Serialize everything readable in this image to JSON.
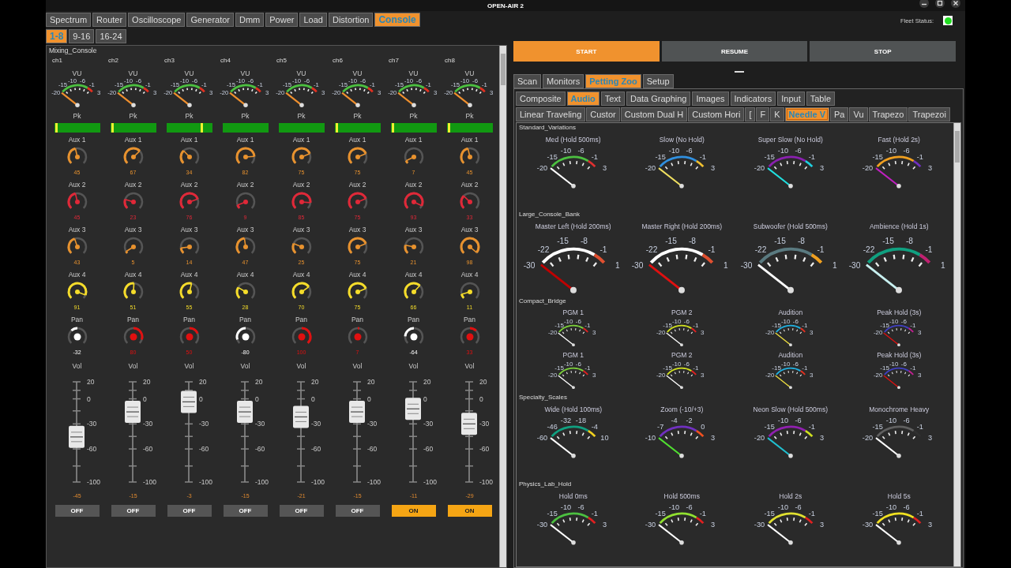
{
  "window": {
    "title": "OPEN-AIR 2"
  },
  "main_tabs": [
    {
      "label": "Spectrum",
      "selected": false
    },
    {
      "label": "Router",
      "selected": false
    },
    {
      "label": "Oscilloscope",
      "selected": false
    },
    {
      "label": "Generator",
      "selected": false
    },
    {
      "label": "Dmm",
      "selected": false
    },
    {
      "label": "Power",
      "selected": false
    },
    {
      "label": "Load",
      "selected": false
    },
    {
      "label": "Distortion",
      "selected": false
    },
    {
      "label": "Console",
      "selected": true
    }
  ],
  "bank_tabs": [
    {
      "label": "1-8",
      "selected": true
    },
    {
      "label": "9-16",
      "selected": false
    },
    {
      "label": "16-24",
      "selected": false
    }
  ],
  "console": {
    "title": "Mixing_Console",
    "channels": [
      {
        "name": "ch1",
        "vu": {
          "label": "VU",
          "scale": [
            "-20",
            "-15",
            "-10",
            "-6",
            "-1",
            "3"
          ]
        },
        "peak": {
          "label": "Pk",
          "level": 0.02
        },
        "knobs": [
          {
            "kind": "aux",
            "label": "Aux 1",
            "reading": "45",
            "color": "#e8922e"
          },
          {
            "kind": "aux",
            "label": "Aux 2",
            "reading": "45",
            "color": "#e02838"
          },
          {
            "kind": "aux",
            "label": "Aux 3",
            "reading": "43",
            "color": "#e8922e"
          },
          {
            "kind": "aux",
            "label": "Aux 4",
            "reading": "91",
            "color": "#f5dc2a"
          },
          {
            "kind": "pan",
            "label": "Pan",
            "reading": "-32",
            "color": "#ffffff"
          }
        ],
        "fader": {
          "label": "Vol",
          "scale": [
            "20",
            "0",
            "-30",
            "-60",
            "-100"
          ],
          "level": 0.45,
          "reading": "-45"
        },
        "mute": {
          "label": "OFF",
          "on": false
        }
      },
      {
        "name": "ch2",
        "vu": {
          "label": "VU",
          "scale": [
            "-20",
            "-15",
            "-10",
            "-6",
            "-1",
            "3"
          ]
        },
        "peak": {
          "label": "Pk",
          "level": 0.02
        },
        "knobs": [
          {
            "kind": "aux",
            "label": "Aux 1",
            "reading": "67",
            "color": "#e8922e"
          },
          {
            "kind": "aux",
            "label": "Aux 2",
            "reading": "23",
            "color": "#e02838"
          },
          {
            "kind": "aux",
            "label": "Aux 3",
            "reading": "5",
            "color": "#e8922e"
          },
          {
            "kind": "aux",
            "label": "Aux 4",
            "reading": "51",
            "color": "#f5dc2a"
          },
          {
            "kind": "pan",
            "label": "Pan",
            "reading": "80",
            "color": "#e01010"
          }
        ],
        "fader": {
          "label": "Vol",
          "scale": [
            "20",
            "0",
            "-30",
            "-60",
            "-100"
          ],
          "level": 0.7,
          "reading": "-15"
        },
        "mute": {
          "label": "OFF",
          "on": false
        }
      },
      {
        "name": "ch3",
        "vu": {
          "label": "VU",
          "scale": [
            "-20",
            "-15",
            "-10",
            "-6",
            "-1",
            "3"
          ]
        },
        "peak": {
          "label": "Pk",
          "level": 0.75
        },
        "knobs": [
          {
            "kind": "aux",
            "label": "Aux 1",
            "reading": "34",
            "color": "#e8922e"
          },
          {
            "kind": "aux",
            "label": "Aux 2",
            "reading": "76",
            "color": "#e02838"
          },
          {
            "kind": "aux",
            "label": "Aux 3",
            "reading": "14",
            "color": "#e8922e"
          },
          {
            "kind": "aux",
            "label": "Aux 4",
            "reading": "55",
            "color": "#f5dc2a"
          },
          {
            "kind": "pan",
            "label": "Pan",
            "reading": "50",
            "color": "#e01010"
          }
        ],
        "fader": {
          "label": "Vol",
          "scale": [
            "20",
            "0",
            "-30",
            "-60",
            "-100"
          ],
          "level": 0.8,
          "reading": "-3"
        },
        "mute": {
          "label": "OFF",
          "on": false
        }
      },
      {
        "name": "ch4",
        "vu": {
          "label": "VU",
          "scale": [
            "-20",
            "-15",
            "-10",
            "-6",
            "-1",
            "3"
          ]
        },
        "peak": {
          "label": "Pk"
        },
        "knobs": [
          {
            "kind": "aux",
            "label": "Aux 1",
            "reading": "82",
            "color": "#e8922e"
          },
          {
            "kind": "aux",
            "label": "Aux 2",
            "reading": "9",
            "color": "#e02838"
          },
          {
            "kind": "aux",
            "label": "Aux 3",
            "reading": "47",
            "color": "#e8922e"
          },
          {
            "kind": "aux",
            "label": "Aux 4",
            "reading": "28",
            "color": "#f5dc2a"
          },
          {
            "kind": "pan",
            "label": "Pan",
            "reading": "-80",
            "color": "#ffffff"
          }
        ],
        "fader": {
          "label": "Vol",
          "scale": [
            "20",
            "0",
            "-30",
            "-60",
            "-100"
          ],
          "level": 0.7,
          "reading": "-15"
        },
        "mute": {
          "label": "OFF",
          "on": false
        }
      },
      {
        "name": "ch5",
        "vu": {
          "label": "VU",
          "scale": [
            "-20",
            "-15",
            "-10",
            "-6",
            "-1",
            "3"
          ]
        },
        "peak": {
          "label": "Pk"
        },
        "knobs": [
          {
            "kind": "aux",
            "label": "Aux 1",
            "reading": "75",
            "color": "#e8922e"
          },
          {
            "kind": "aux",
            "label": "Aux 2",
            "reading": "85",
            "color": "#e02838"
          },
          {
            "kind": "aux",
            "label": "Aux 3",
            "reading": "25",
            "color": "#e8922e"
          },
          {
            "kind": "aux",
            "label": "Aux 4",
            "reading": "70",
            "color": "#f5dc2a"
          },
          {
            "kind": "pan",
            "label": "Pan",
            "reading": "100",
            "color": "#e01010"
          }
        ],
        "fader": {
          "label": "Vol",
          "scale": [
            "20",
            "0",
            "-30",
            "-60",
            "-100"
          ],
          "level": 0.65,
          "reading": "-21"
        },
        "mute": {
          "label": "OFF",
          "on": false
        }
      },
      {
        "name": "ch6",
        "vu": {
          "label": "VU",
          "scale": [
            "-20",
            "-15",
            "-10",
            "-6",
            "-1",
            "3"
          ]
        },
        "peak": {
          "label": "Pk",
          "level": 0.02
        },
        "knobs": [
          {
            "kind": "aux",
            "label": "Aux 1",
            "reading": "75",
            "color": "#e8922e"
          },
          {
            "kind": "aux",
            "label": "Aux 2",
            "reading": "75",
            "color": "#e02838"
          },
          {
            "kind": "aux",
            "label": "Aux 3",
            "reading": "75",
            "color": "#e8922e"
          },
          {
            "kind": "aux",
            "label": "Aux 4",
            "reading": "75",
            "color": "#f5dc2a"
          },
          {
            "kind": "pan",
            "label": "Pan",
            "reading": "7",
            "color": "#e01010"
          }
        ],
        "fader": {
          "label": "Vol",
          "scale": [
            "20",
            "0",
            "-30",
            "-60",
            "-100"
          ],
          "level": 0.7,
          "reading": "-15"
        },
        "mute": {
          "label": "OFF",
          "on": false
        }
      },
      {
        "name": "ch7",
        "vu": {
          "label": "VU",
          "scale": [
            "-20",
            "-15",
            "-10",
            "-6",
            "-1",
            "3"
          ]
        },
        "peak": {
          "label": "Pk",
          "level": 0.02
        },
        "knobs": [
          {
            "kind": "aux",
            "label": "Aux 1",
            "reading": "7",
            "color": "#e8922e"
          },
          {
            "kind": "aux",
            "label": "Aux 2",
            "reading": "93",
            "color": "#e02838"
          },
          {
            "kind": "aux",
            "label": "Aux 3",
            "reading": "21",
            "color": "#e8922e"
          },
          {
            "kind": "aux",
            "label": "Aux 4",
            "reading": "66",
            "color": "#f5dc2a"
          },
          {
            "kind": "pan",
            "label": "Pan",
            "reading": "-64",
            "color": "#ffffff"
          }
        ],
        "fader": {
          "label": "Vol",
          "scale": [
            "20",
            "0",
            "-30",
            "-60",
            "-100"
          ],
          "level": 0.73,
          "reading": "-11"
        },
        "mute": {
          "label": "ON",
          "on": true
        }
      },
      {
        "name": "ch8",
        "vu": {
          "label": "VU",
          "scale": [
            "-20",
            "-15",
            "-10",
            "-6",
            "-1",
            "3"
          ]
        },
        "peak": {
          "label": "Pk",
          "level": 0.02
        },
        "knobs": [
          {
            "kind": "aux",
            "label": "Aux 1",
            "reading": "45",
            "color": "#e8922e"
          },
          {
            "kind": "aux",
            "label": "Aux 2",
            "reading": "33",
            "color": "#e02838"
          },
          {
            "kind": "aux",
            "label": "Aux 3",
            "reading": "98",
            "color": "#e8922e"
          },
          {
            "kind": "aux",
            "label": "Aux 4",
            "reading": "11",
            "color": "#f5dc2a"
          },
          {
            "kind": "pan",
            "label": "Pan",
            "reading": "33",
            "color": "#e01010"
          }
        ],
        "fader": {
          "label": "Vol",
          "scale": [
            "20",
            "0",
            "-30",
            "-60",
            "-100"
          ],
          "level": 0.58,
          "reading": "-29"
        },
        "mute": {
          "label": "ON",
          "on": true
        }
      }
    ]
  },
  "fleet_status": {
    "label": "Fleet Status:",
    "color": "#22dd22"
  },
  "transport": [
    {
      "label": "START",
      "selected": true
    },
    {
      "label": "RESUME",
      "selected": false
    },
    {
      "label": "STOP",
      "selected": false
    }
  ],
  "page_tabs": [
    {
      "label": "Scan",
      "selected": false
    },
    {
      "label": "Monitors",
      "selected": false
    },
    {
      "label": "Petting Zoo",
      "selected": true
    },
    {
      "label": "Setup",
      "selected": false
    }
  ],
  "category_tabs": [
    {
      "label": "Composite",
      "selected": false
    },
    {
      "label": "Audio",
      "selected": true
    },
    {
      "label": "Text",
      "selected": false
    },
    {
      "label": "Data Graphing",
      "selected": false
    },
    {
      "label": "Images",
      "selected": false
    },
    {
      "label": "Indicators",
      "selected": false
    },
    {
      "label": "Input",
      "selected": false
    },
    {
      "label": "Table",
      "selected": false
    }
  ],
  "widget_tabs": [
    {
      "label": "Linear Traveling",
      "selected": false
    },
    {
      "label": "Custor",
      "selected": false
    },
    {
      "label": "Custom Dual H",
      "selected": false
    },
    {
      "label": "Custom Hori",
      "selected": false
    },
    {
      "label": "[",
      "selected": false
    },
    {
      "label": "F",
      "selected": false
    },
    {
      "label": "K",
      "selected": false
    },
    {
      "label": "Needle V",
      "selected": true
    },
    {
      "label": "Pa",
      "selected": false
    },
    {
      "label": "Vu",
      "selected": false
    },
    {
      "label": "Trapezo",
      "selected": false
    },
    {
      "label": "Trapezoi",
      "selected": false
    }
  ],
  "sections": [
    {
      "title": "Standard_Variations",
      "kind": "medium",
      "gauges": [
        {
          "title": "Med (Hold 500ms)",
          "scale": [
            "-20",
            "-15",
            "-10",
            "-6",
            "-1",
            "3"
          ],
          "arc": {
            "color": "#4cc040"
          },
          "end_zone": {
            "color": "#e03030"
          },
          "needle": {
            "color": "#ffffff"
          }
        },
        {
          "title": "Slow (No Hold)",
          "scale": [
            "-20",
            "-15",
            "-10",
            "-6",
            "-1",
            "3"
          ],
          "arc": {
            "color": "#3090e0"
          },
          "end_zone": {
            "color": "#f0c030"
          },
          "needle": {
            "color": "#f0e060"
          }
        },
        {
          "title": "Super Slow (No Hold)",
          "scale": [
            "-20",
            "-15",
            "-10",
            "-6",
            "-1",
            "3"
          ],
          "arc": {
            "color": "#8a20b0"
          },
          "end_zone": {
            "color": "#20d0e0"
          },
          "needle": {
            "color": "#20e0e0"
          }
        },
        {
          "title": "Fast (Hold 2s)",
          "scale": [
            "-20",
            "-15",
            "-10",
            "-6",
            "-1",
            "3"
          ],
          "arc": {
            "color": "#f0a020"
          },
          "end_zone": {
            "color": "#7030c0"
          },
          "needle": {
            "color": "#c020c0"
          }
        }
      ]
    },
    {
      "title": "Large_Console_Bank",
      "kind": "large",
      "gauges": [
        {
          "title": "Master Left (Hold 200ms)",
          "scale": [
            "-30",
            "-22",
            "-15",
            "-8",
            "-1",
            "1"
          ],
          "arc": {
            "color": "#ffffff"
          },
          "end_zone": {
            "color": "#e05030"
          },
          "needle": {
            "color": "#c00000"
          }
        },
        {
          "title": "Master Right (Hold 200ms)",
          "scale": [
            "-30",
            "-22",
            "-15",
            "-8",
            "-1",
            "1"
          ],
          "arc": {
            "color": "#ffffff"
          },
          "end_zone": {
            "color": "#e05030"
          },
          "needle": {
            "color": "#e01010"
          }
        },
        {
          "title": "Subwoofer (Hold 500ms)",
          "scale": [
            "-30",
            "-22",
            "-15",
            "-8",
            "-1",
            "1"
          ],
          "arc": {
            "color": "#5a7a80"
          },
          "end_zone": {
            "color": "#f0a020"
          },
          "needle": {
            "color": "#ffffff"
          }
        },
        {
          "title": "Ambience (Hold 1s)",
          "scale": [
            "-30",
            "-22",
            "-15",
            "-8",
            "-1",
            "1"
          ],
          "arc": {
            "color": "#10a080"
          },
          "end_zone": {
            "color": "#c02070"
          },
          "needle": {
            "color": "#c8f0f0"
          }
        }
      ]
    },
    {
      "title": "Compact_Bridge",
      "kind": "small",
      "gauges": [
        {
          "title": "PGM 1",
          "scale": [
            "-20",
            "-15",
            "-10",
            "-6",
            "-1",
            "3"
          ],
          "arc": {
            "color": "#7bd03a"
          },
          "end_zone": {
            "color": "#e02020"
          },
          "needle": {
            "color": "#ffffff"
          }
        },
        {
          "title": "PGM 2",
          "scale": [
            "-20",
            "-15",
            "-10",
            "-6",
            "-1",
            "3"
          ],
          "arc": {
            "color": "#d0e020"
          },
          "end_zone": {
            "color": "#e02020"
          },
          "needle": {
            "color": "#ffffff"
          }
        },
        {
          "title": "Audition",
          "scale": [
            "-20",
            "-15",
            "-10",
            "-6",
            "-1",
            "3"
          ],
          "arc": {
            "color": "#20b0e0"
          },
          "end_zone": {
            "color": "#e03020"
          },
          "needle": {
            "color": "#f0e040"
          }
        },
        {
          "title": "Peak Hold (3s)",
          "scale": [
            "-20",
            "-15",
            "-10",
            "-6",
            "-1",
            "3"
          ],
          "arc": {
            "color": "#4040c0"
          },
          "end_zone": {
            "color": "#c02090"
          },
          "needle": {
            "color": "#e01010"
          }
        },
        {
          "title": "PGM 1",
          "scale": [
            "-20",
            "-15",
            "-10",
            "-6",
            "-1",
            "3"
          ],
          "arc": {
            "color": "#7bd03a"
          },
          "end_zone": {
            "color": "#e02020"
          },
          "needle": {
            "color": "#ffffff"
          }
        },
        {
          "title": "PGM 2",
          "scale": [
            "-20",
            "-15",
            "-10",
            "-6",
            "-1",
            "3"
          ],
          "arc": {
            "color": "#d0e020"
          },
          "end_zone": {
            "color": "#e02020"
          },
          "needle": {
            "color": "#ffffff"
          }
        },
        {
          "title": "Audition",
          "scale": [
            "-20",
            "-15",
            "-10",
            "-6",
            "-1",
            "3"
          ],
          "arc": {
            "color": "#20b0e0"
          },
          "end_zone": {
            "color": "#e03020"
          },
          "needle": {
            "color": "#f0e040"
          }
        },
        {
          "title": "Peak Hold (3s)",
          "scale": [
            "-20",
            "-15",
            "-10",
            "-6",
            "-1",
            "3"
          ],
          "arc": {
            "color": "#4040c0"
          },
          "end_zone": {
            "color": "#c02090"
          },
          "needle": {
            "color": "#e01010"
          }
        }
      ]
    },
    {
      "title": "Specialty_Scales",
      "kind": "medium",
      "gauges": [
        {
          "title": "Wide (Hold 100ms)",
          "scale": [
            "-60",
            "-46",
            "-32",
            "-18",
            "-4",
            "10"
          ],
          "arc": {
            "color": "#10a080"
          },
          "end_zone": {
            "color": "#f0d020"
          },
          "needle": {
            "color": "#ffffff"
          }
        },
        {
          "title": "Zoom (-10/+3)",
          "scale": [
            "-10",
            "-7",
            "-4",
            "-2",
            "0",
            "3"
          ],
          "arc": {
            "color": "#7030c0"
          },
          "end_zone": {
            "color": "#f05020"
          },
          "needle": {
            "color": "#50e030"
          }
        },
        {
          "title": "Neon Slow (Hold 500ms)",
          "scale": [
            "-20",
            "-15",
            "-10",
            "-6",
            "-1",
            "3"
          ],
          "arc": {
            "color": "#9020b0"
          },
          "end_zone": {
            "color": "#d0e020"
          },
          "needle": {
            "color": "#20c0d0"
          }
        },
        {
          "title": "Monochrome Heavy",
          "scale": [
            "-20",
            "-15",
            "-10",
            "-6",
            "-1",
            "3"
          ],
          "arc": {
            "color": "#606060"
          },
          "end_zone": {
            "color": "#303030"
          },
          "needle": {
            "color": "#ffffff"
          }
        }
      ]
    },
    {
      "title": "Physics_Lab_Hold",
      "kind": "medium",
      "gauges": [
        {
          "title": "Hold 0ms",
          "scale": [
            "-30",
            "-15",
            "-10",
            "-6",
            "-1",
            "3"
          ],
          "arc": {
            "color": "#4cc040"
          },
          "end_zone": {
            "color": "#e02020"
          },
          "needle": {
            "color": "#ffffff"
          }
        },
        {
          "title": "Hold 500ms",
          "scale": [
            "-30",
            "-15",
            "-10",
            "-6",
            "-1",
            "3"
          ],
          "arc": {
            "color": "#90e030"
          },
          "end_zone": {
            "color": "#e02020"
          },
          "needle": {
            "color": "#ffffff"
          }
        },
        {
          "title": "Hold 2s",
          "scale": [
            "-30",
            "-15",
            "-10",
            "-6",
            "-1",
            "3"
          ],
          "arc": {
            "color": "#e0e030"
          },
          "end_zone": {
            "color": "#e02020"
          },
          "needle": {
            "color": "#ffffff"
          }
        },
        {
          "title": "Hold 5s",
          "scale": [
            "-30",
            "-15",
            "-10",
            "-6",
            "-1",
            "3"
          ],
          "arc": {
            "color": "#f0e020"
          },
          "end_zone": {
            "color": "#e02020"
          },
          "needle": {
            "color": "#ffffff"
          }
        }
      ]
    }
  ]
}
